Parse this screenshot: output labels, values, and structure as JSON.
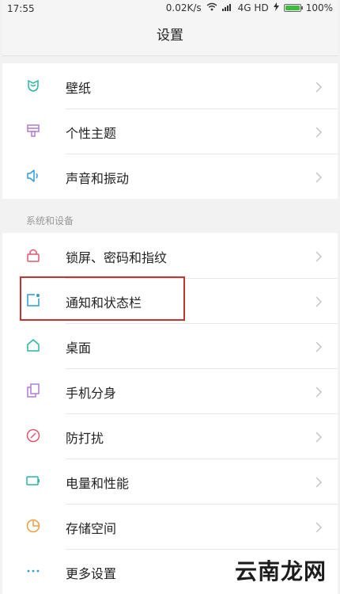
{
  "status_bar": {
    "time": "17:55",
    "network_speed": "0.02K/s",
    "network_type": "4G HD",
    "battery": "100%",
    "icons": [
      "wifi-icon",
      "signal-icon",
      "charging-icon",
      "battery-icon"
    ],
    "battery_color": "#3bbf3b"
  },
  "header": {
    "title": "设置"
  },
  "group1": {
    "items": [
      {
        "label": "壁纸",
        "icon": "wallpaper-icon",
        "color": "#29b8a0"
      },
      {
        "label": "个性主题",
        "icon": "theme-brush-icon",
        "color": "#b07ad6"
      },
      {
        "label": "声音和振动",
        "icon": "speaker-icon",
        "color": "#2e9bd6"
      }
    ]
  },
  "section2": {
    "title": "系统和设备",
    "items": [
      {
        "label": "锁屏、密码和指纹",
        "icon": "lock-icon",
        "color": "#e0566f"
      },
      {
        "label": "通知和状态栏",
        "icon": "notification-icon",
        "color": "#2e9bd6"
      },
      {
        "label": "桌面",
        "icon": "home-icon",
        "color": "#29b8a0"
      },
      {
        "label": "手机分身",
        "icon": "dual-space-icon",
        "color": "#b07ad6"
      },
      {
        "label": "防打扰",
        "icon": "do-not-disturb-icon",
        "color": "#e0566f"
      },
      {
        "label": "电量和性能",
        "icon": "battery-performance-icon",
        "color": "#29b8a0"
      },
      {
        "label": "存储空间",
        "icon": "storage-pie-icon",
        "color": "#e8a040"
      },
      {
        "label": "更多设置",
        "icon": "more-dots-icon",
        "color": "#2e9bd6"
      }
    ]
  },
  "highlight_color": "#c8322f",
  "watermark": "云南龙网"
}
